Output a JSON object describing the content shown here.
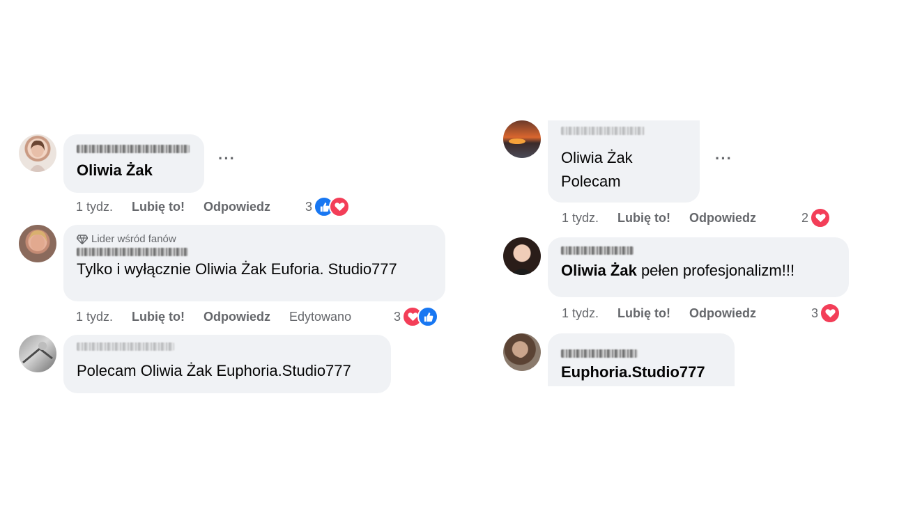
{
  "colors": {
    "bubble": "#f0f2f5",
    "muted": "#65676b",
    "like": "#1877f2",
    "love": "#f33e58"
  },
  "left": [
    {
      "text": "Oliwia Żak",
      "actions": {
        "time": "1 tydz.",
        "like": "Lubię to!",
        "reply": "Odpowiedz"
      },
      "reaction_count": "3",
      "reactions": [
        "like-icon",
        "love-icon"
      ]
    },
    {
      "badge": "Lider wśród fanów",
      "text": "Tylko i wyłącznie Oliwia Żak Euforia. Studio777",
      "actions": {
        "time": "1 tydz.",
        "like": "Lubię to!",
        "reply": "Odpowiedz",
        "edited": "Edytowano"
      },
      "reaction_count": "3",
      "reactions": [
        "love-icon",
        "like-icon"
      ]
    },
    {
      "text": "Polecam Oliwia Żak Euphoria.Studio777"
    }
  ],
  "right": [
    {
      "line1": "Oliwia Żak",
      "line2": "Polecam",
      "actions": {
        "time": "1 tydz.",
        "like": "Lubię to!",
        "reply": "Odpowiedz"
      },
      "reaction_count": "2",
      "reactions": [
        "love-icon"
      ]
    },
    {
      "tag": "Oliwia Żak",
      "rest": " pełen profesjonalizm!!!",
      "actions": {
        "time": "1 tydz.",
        "like": "Lubię to!",
        "reply": "Odpowiedz"
      },
      "reaction_count": "3",
      "reactions": [
        "love-icon"
      ]
    },
    {
      "tag": "Euphoria.Studio777"
    }
  ],
  "more_label": "···"
}
